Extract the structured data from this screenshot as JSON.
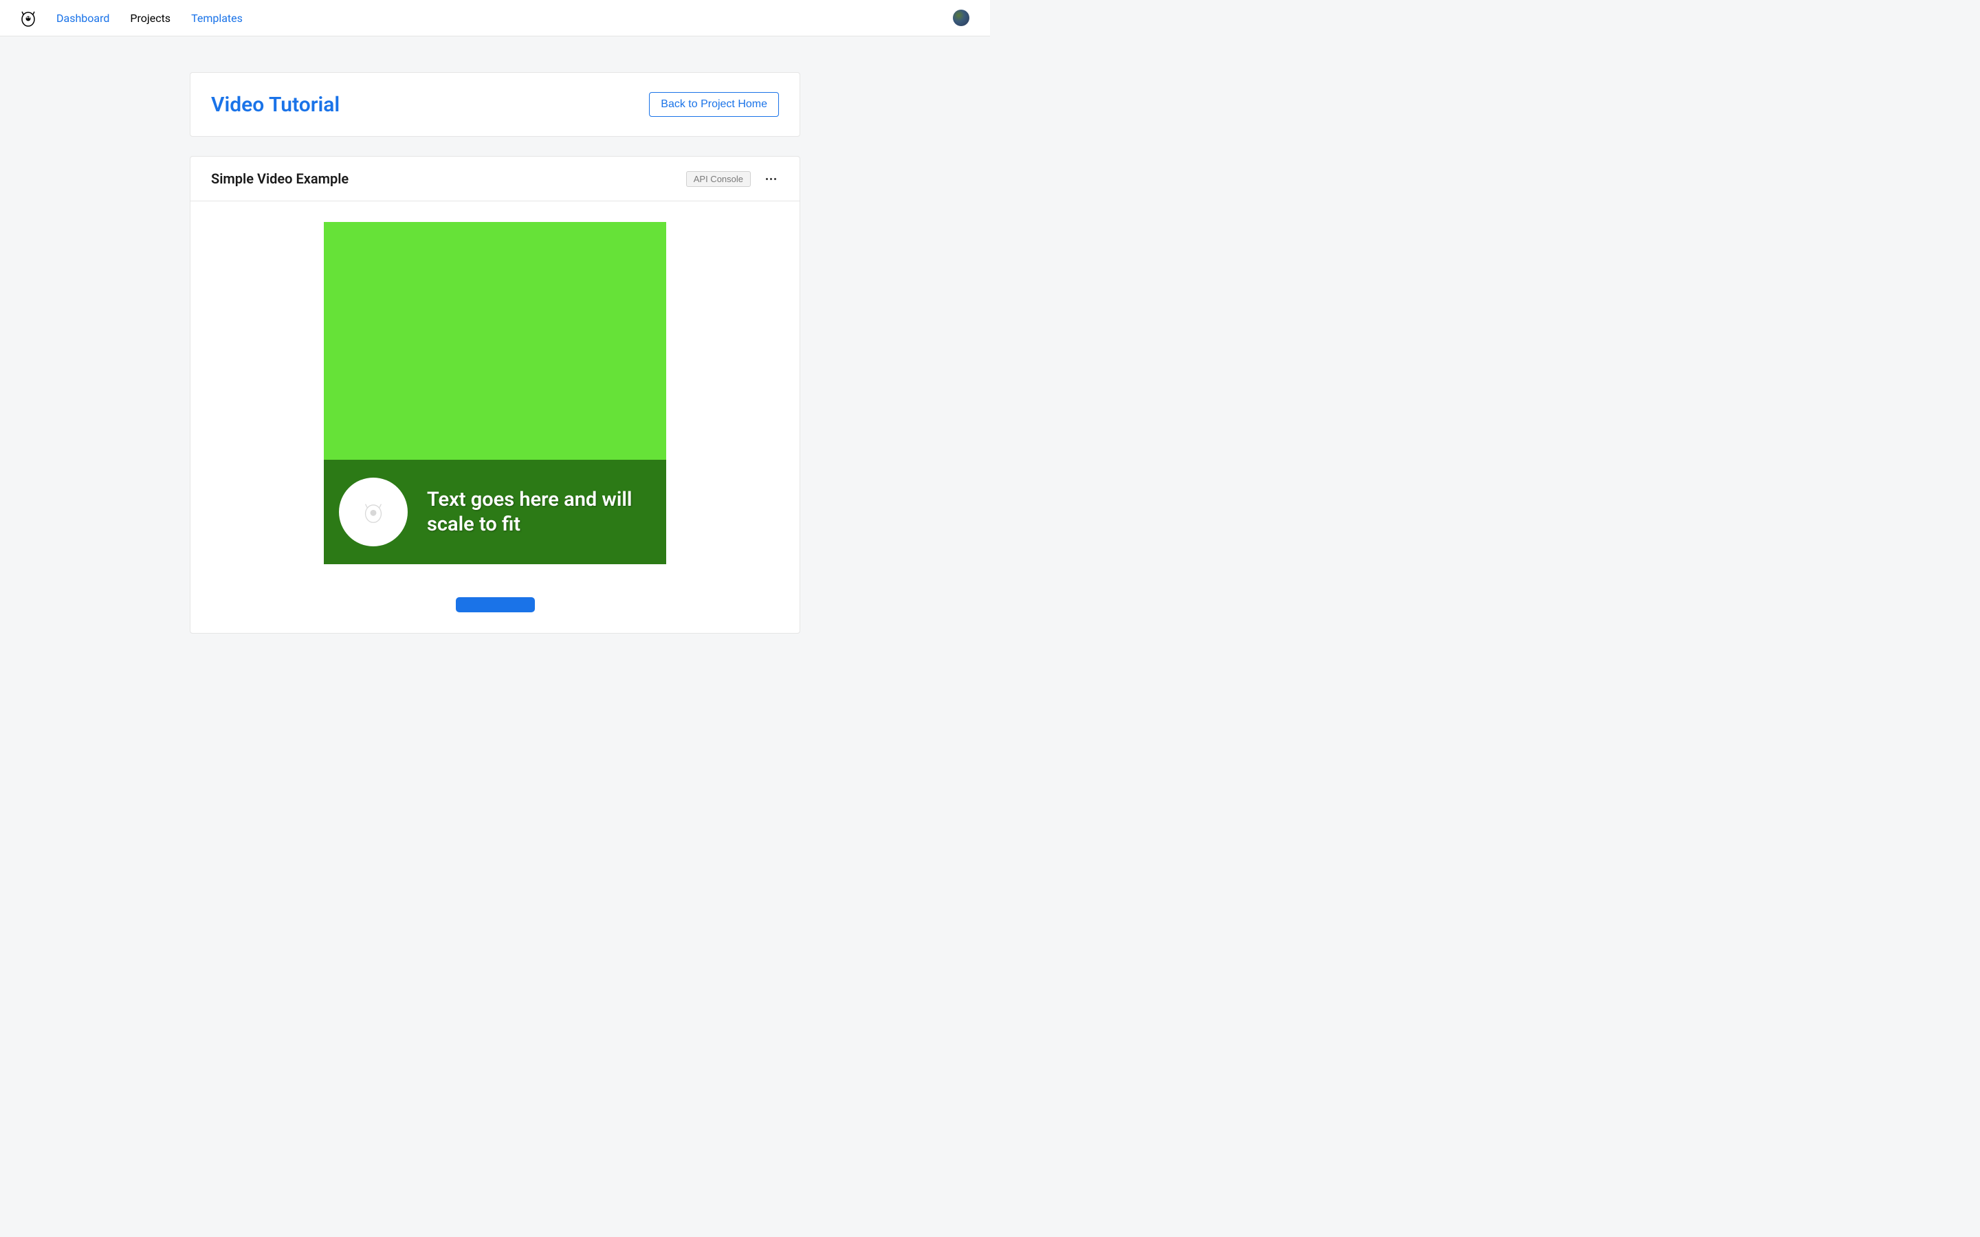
{
  "nav": {
    "items": [
      {
        "label": "Dashboard",
        "active": false
      },
      {
        "label": "Projects",
        "active": true
      },
      {
        "label": "Templates",
        "active": false
      }
    ]
  },
  "page": {
    "title": "Video Tutorial",
    "back_button_label": "Back to Project Home"
  },
  "card": {
    "title": "Simple Video Example",
    "api_console_label": "API Console"
  },
  "preview": {
    "overlay_text": "Text goes here and will scale to fit",
    "colors": {
      "upper": "#66e238",
      "lower": "#2c7a16"
    }
  }
}
